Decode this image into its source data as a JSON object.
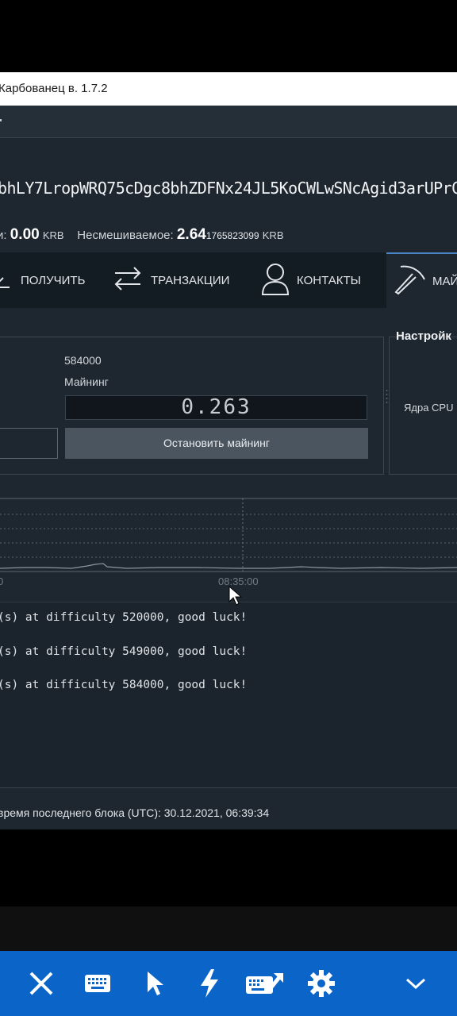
{
  "window": {
    "title": "Карбованец в. 1.7.2"
  },
  "wallet": {
    "address": "bhLY7LropWRQ75cDgc8bhZDFNx24JL5KoCWLwSNcAgid3arUPrC",
    "balance_label": "и:",
    "balance_value": "0.00",
    "balance_unit": "KRB",
    "unmixable_label": "Несмешиваемое:",
    "unmixable_value_main": "2.64",
    "unmixable_value_rest": "1765823099",
    "unmixable_unit": "KRB"
  },
  "tabs": [
    {
      "label": "ПОЛУЧИТЬ",
      "icon": "receive-icon"
    },
    {
      "label": "ТРАНЗАКЦИИ",
      "icon": "transfer-arrows-icon"
    },
    {
      "label": "КОНТАКТЫ",
      "icon": "contact-person-icon"
    },
    {
      "label": "МАЙ",
      "icon": "pickaxe-icon"
    }
  ],
  "mining": {
    "difficulty": "584000",
    "status_label": "Майнинг",
    "hashrate": "0.263",
    "stop_button": "Остановить майнинг"
  },
  "settings": {
    "title": "Настройк",
    "cpu_cores_label": "Ядра CPU"
  },
  "chart": {
    "time_label": "08:35:00",
    "left_label": "0"
  },
  "log": [
    "(s) at difficulty 520000, good luck!",
    "(s) at difficulty 549000, good luck!",
    "(s) at difficulty 584000, good luck!"
  ],
  "status": {
    "text": "время последнего блока (UTC): 30.12.2021, 06:39:34"
  },
  "toolbar": {
    "buttons": [
      "close-icon",
      "keyboard-icon",
      "pointer-icon",
      "lightning-icon",
      "keyboard-send-icon",
      "settings-gear-icon",
      "chevron-down-icon"
    ]
  },
  "colors": {
    "accent": "#0b65c8",
    "panel": "#1e2730",
    "tab_active_border": "#4a86c7"
  }
}
